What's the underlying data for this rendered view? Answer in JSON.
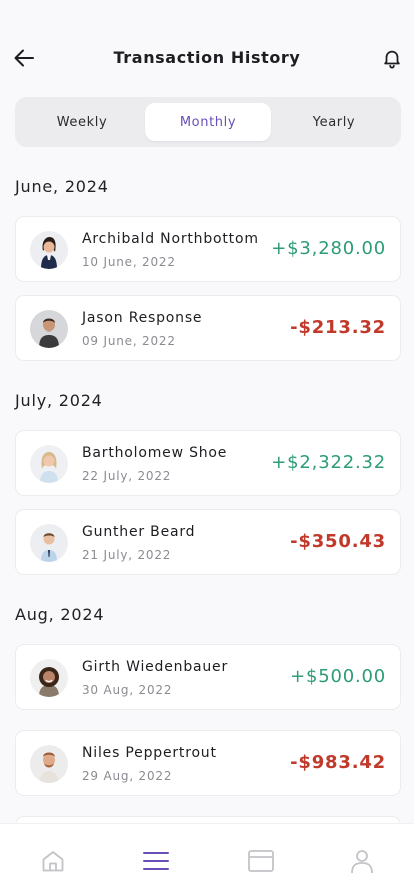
{
  "header": {
    "title": "Transaction History",
    "back_icon": "arrow-left-icon",
    "notification_icon": "bell-icon"
  },
  "tabs": [
    {
      "label": "Weekly",
      "active": false
    },
    {
      "label": "Monthly",
      "active": true
    },
    {
      "label": "Yearly",
      "active": false
    }
  ],
  "sections": [
    {
      "title": "June, 2024",
      "transactions": [
        {
          "name": "Archibald Northbottom",
          "date": "10 June, 2022",
          "amount": "+$3,280.00",
          "type": "credit"
        },
        {
          "name": "Jason Response",
          "date": "09 June, 2022",
          "amount": "-$213.32",
          "type": "debit"
        }
      ]
    },
    {
      "title": "July, 2024",
      "transactions": [
        {
          "name": "Bartholomew Shoe",
          "date": "22 July, 2022",
          "amount": "+$2,322.32",
          "type": "credit"
        },
        {
          "name": "Gunther Beard",
          "date": "21 July, 2022",
          "amount": "-$350.43",
          "type": "debit"
        }
      ]
    },
    {
      "title": "Aug, 2024",
      "transactions": [
        {
          "name": "Girth Wiedenbauer",
          "date": "30 Aug, 2022",
          "amount": "+$500.00",
          "type": "credit"
        },
        {
          "name": "Niles Peppertrout",
          "date": "29 Aug, 2022",
          "amount": "-$983.42",
          "type": "debit"
        }
      ]
    }
  ],
  "bottom_nav": [
    {
      "icon": "home-icon",
      "active": false
    },
    {
      "icon": "list-icon",
      "active": true
    },
    {
      "icon": "card-icon",
      "active": false
    },
    {
      "icon": "user-icon",
      "active": false
    }
  ],
  "colors": {
    "accent": "#6a4fb8",
    "credit": "#2e9c78",
    "debit": "#c0392b",
    "background": "#f9f8fa"
  }
}
